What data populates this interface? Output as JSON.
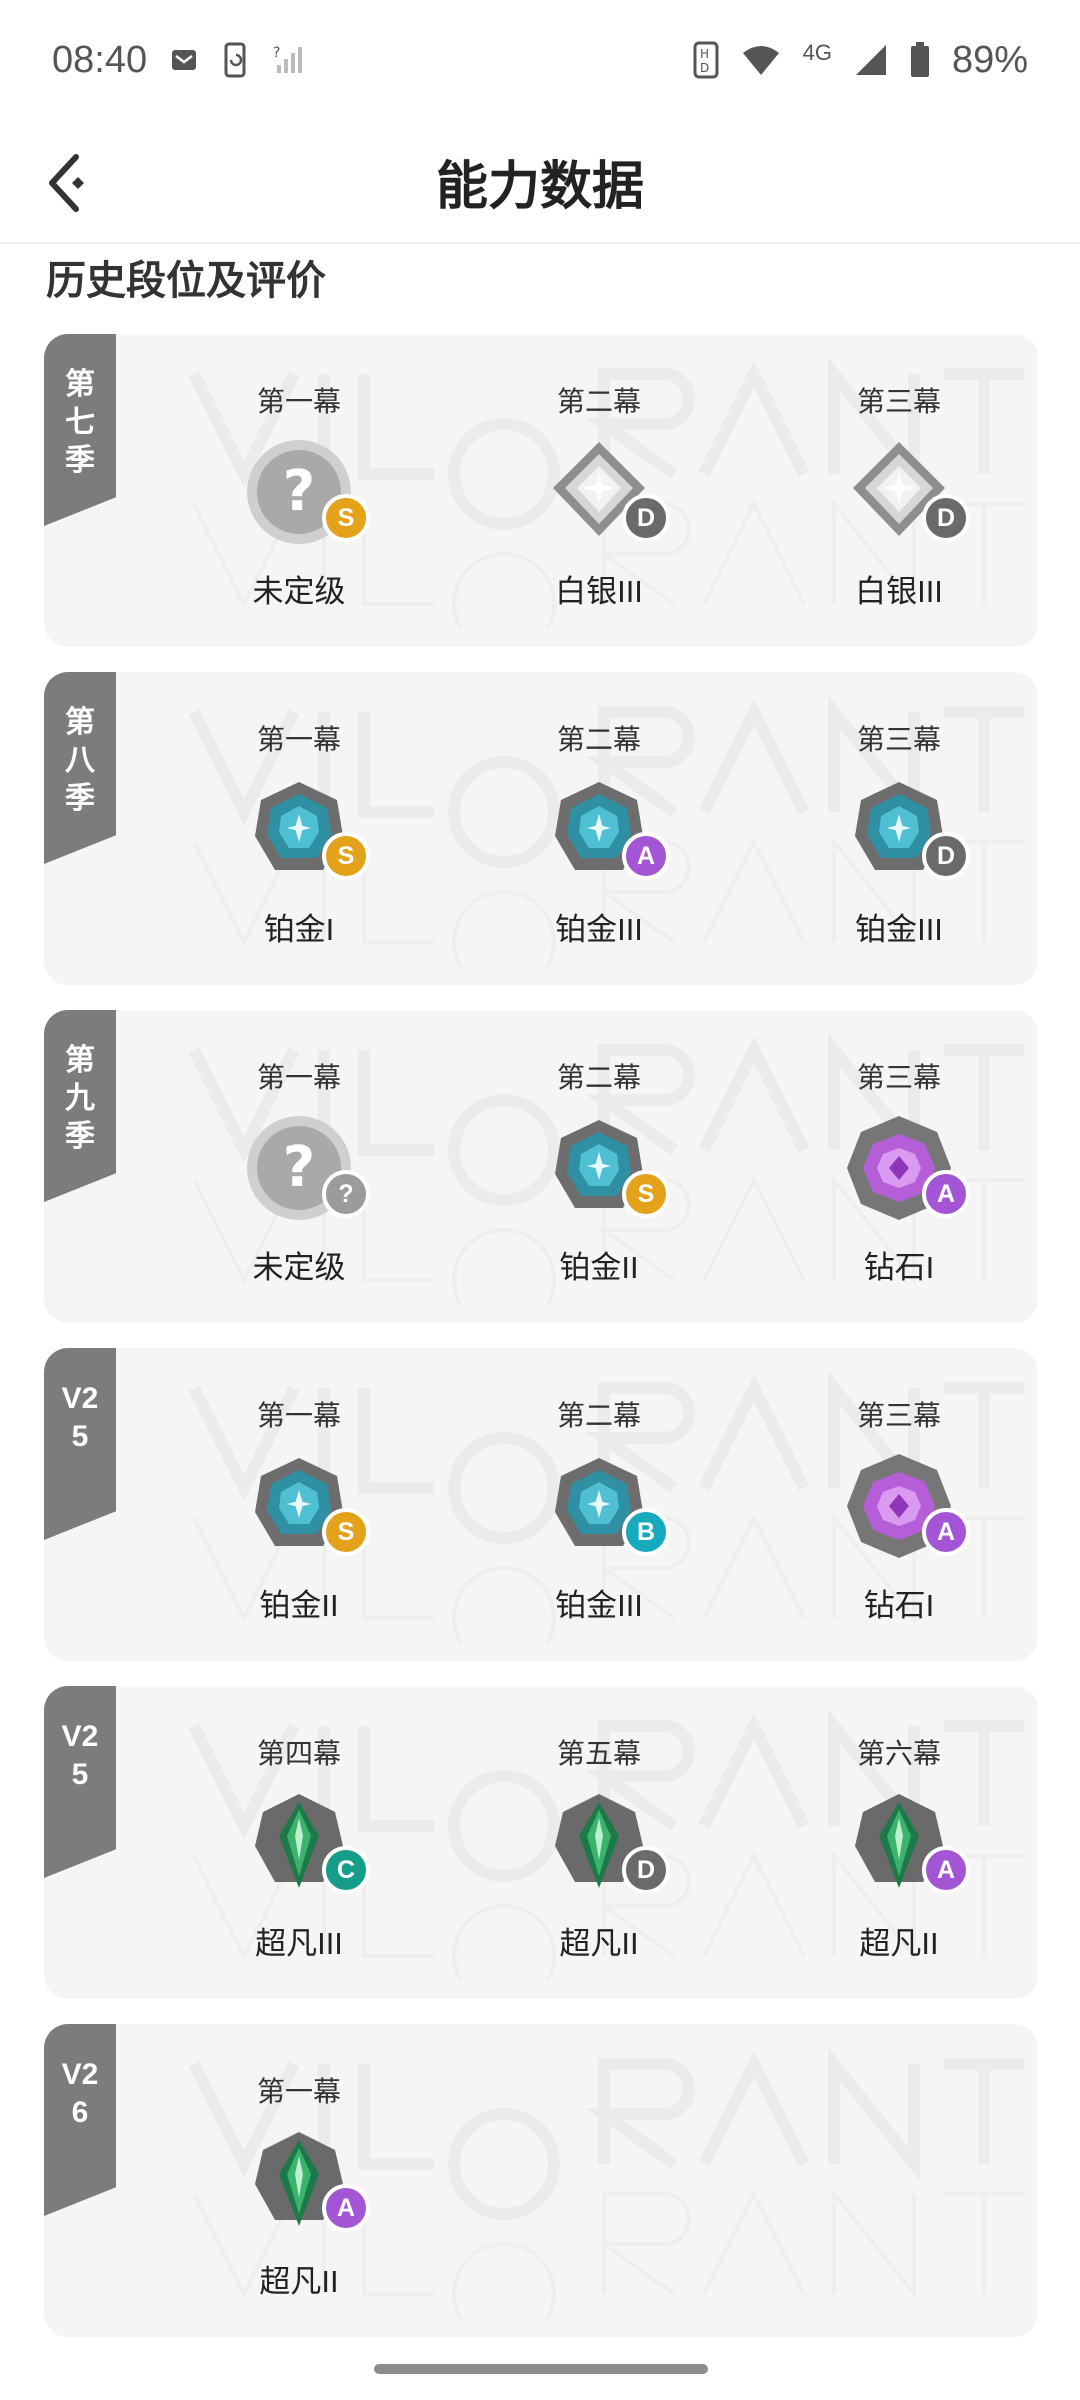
{
  "status_bar": {
    "time": "08:40",
    "network": "4G",
    "battery": "89%"
  },
  "header": {
    "title": "能力数据"
  },
  "section_title": "历史段位及评价",
  "grade_colors": {
    "S": "#e3a21a",
    "A": "#a455d6",
    "B": "#17a9bd",
    "C": "#149e8a",
    "D": "#6a6a6a",
    "?": "#9b9b9b"
  },
  "seasons": [
    {
      "tag": "第七季",
      "acts": [
        {
          "label": "第一幕",
          "rank": "未定级",
          "tier": "unranked",
          "grade": "S"
        },
        {
          "label": "第二幕",
          "rank": "白银III",
          "tier": "silver",
          "grade": "D"
        },
        {
          "label": "第三幕",
          "rank": "白银III",
          "tier": "silver",
          "grade": "D"
        }
      ]
    },
    {
      "tag": "第八季",
      "acts": [
        {
          "label": "第一幕",
          "rank": "铂金I",
          "tier": "platinum",
          "grade": "S"
        },
        {
          "label": "第二幕",
          "rank": "铂金III",
          "tier": "platinum",
          "grade": "A"
        },
        {
          "label": "第三幕",
          "rank": "铂金III",
          "tier": "platinum",
          "grade": "D"
        }
      ]
    },
    {
      "tag": "第九季",
      "acts": [
        {
          "label": "第一幕",
          "rank": "未定级",
          "tier": "unranked",
          "grade": "?"
        },
        {
          "label": "第二幕",
          "rank": "铂金II",
          "tier": "platinum",
          "grade": "S"
        },
        {
          "label": "第三幕",
          "rank": "钻石I",
          "tier": "diamond",
          "grade": "A"
        }
      ]
    },
    {
      "tag": "V25",
      "acts": [
        {
          "label": "第一幕",
          "rank": "铂金II",
          "tier": "platinum",
          "grade": "S"
        },
        {
          "label": "第二幕",
          "rank": "铂金III",
          "tier": "platinum",
          "grade": "B"
        },
        {
          "label": "第三幕",
          "rank": "钻石I",
          "tier": "diamond",
          "grade": "A"
        }
      ]
    },
    {
      "tag": "V25",
      "acts": [
        {
          "label": "第四幕",
          "rank": "超凡III",
          "tier": "ascendant",
          "grade": "C"
        },
        {
          "label": "第五幕",
          "rank": "超凡II",
          "tier": "ascendant",
          "grade": "D"
        },
        {
          "label": "第六幕",
          "rank": "超凡II",
          "tier": "ascendant",
          "grade": "A"
        }
      ]
    },
    {
      "tag": "V26",
      "acts": [
        {
          "label": "第一幕",
          "rank": "超凡II",
          "tier": "ascendant",
          "grade": "A"
        }
      ]
    }
  ]
}
